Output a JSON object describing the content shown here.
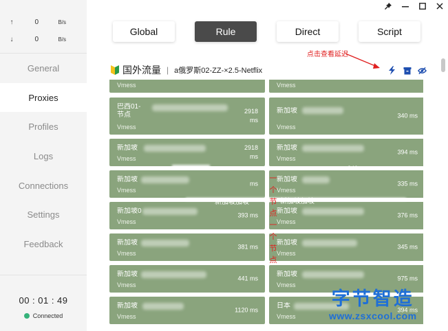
{
  "window": {
    "controls": [
      {
        "name": "pin-icon",
        "glyph": "📌"
      },
      {
        "name": "minimize-icon",
        "glyph": "—"
      },
      {
        "name": "maximize-icon",
        "glyph": "☐"
      },
      {
        "name": "close-icon",
        "glyph": "✕"
      }
    ]
  },
  "traffic": {
    "upload": {
      "arrow": "↑",
      "value": "0",
      "unit": "B/s"
    },
    "download": {
      "arrow": "↓",
      "value": "0",
      "unit": "B/s"
    }
  },
  "sidebar": {
    "items": [
      {
        "label": "General"
      },
      {
        "label": "Proxies"
      },
      {
        "label": "Profiles"
      },
      {
        "label": "Logs"
      },
      {
        "label": "Connections"
      },
      {
        "label": "Settings"
      },
      {
        "label": "Feedback"
      }
    ],
    "timer": "00 : 01 : 49",
    "status": "Connected"
  },
  "modes": [
    "Global",
    "Rule",
    "Direct",
    "Script"
  ],
  "group": {
    "name": "国外流量",
    "separator": "|",
    "selected": "a俄罗斯02-ZZ-×2.5-Netflix",
    "annotation": "点击查看延迟",
    "icons": [
      "lightning-icon",
      "archive-icon",
      "eye-off-icon"
    ]
  },
  "proxies": {
    "left": [
      {
        "name": "",
        "type": "Vmess",
        "delay": ""
      },
      {
        "name": "巴西01-\n节点",
        "type": "Vmess",
        "delay": "2918\nms"
      },
      {
        "name": "新加坡",
        "type": "Vmess",
        "delay": "2918\nms"
      },
      {
        "name": "新加坡",
        "type": "Vmess",
        "delay": "ms"
      },
      {
        "name": "新加坡0",
        "type": "Vmess",
        "delay": "393 ms"
      },
      {
        "name": "新加坡",
        "type": "Vmess",
        "delay": "381 ms"
      },
      {
        "name": "新加坡",
        "type": "Vmess",
        "delay": "441 ms"
      },
      {
        "name": "新加坡",
        "type": "Vmess",
        "delay": "1120 ms"
      }
    ],
    "right": [
      {
        "name": "",
        "type": "Vmess",
        "delay": ""
      },
      {
        "name": "新加坡",
        "type": "Vmess",
        "delay": "340 ms"
      },
      {
        "name": "新加坡",
        "type": "Vmess",
        "delay": "394 ms"
      },
      {
        "name": "新加坡",
        "type": "Vmess",
        "delay": "335 ms"
      },
      {
        "name": "新加坡",
        "type": "Vmess",
        "delay": "376 ms"
      },
      {
        "name": "新加坡",
        "type": "Vmess",
        "delay": "345 ms"
      },
      {
        "name": "新加坡",
        "type": "Vmess",
        "delay": "975 ms"
      },
      {
        "name": "日本",
        "type": "Vmess",
        "delay": "394 ms"
      }
    ]
  },
  "overlay": {
    "stray_text_1": "340 n",
    "stray_text_2": "新加坡加坡",
    "stray_text_3": "新加坡加坡",
    "vertical_note": "一个节点一个节点",
    "watermark_big": "字节智造",
    "watermark_small": "www.zsxcool.com"
  },
  "colors": {
    "card": "#8aa47d",
    "accent": "#1f6fd6",
    "annotation": "#e02020",
    "connected": "#35b27a"
  }
}
